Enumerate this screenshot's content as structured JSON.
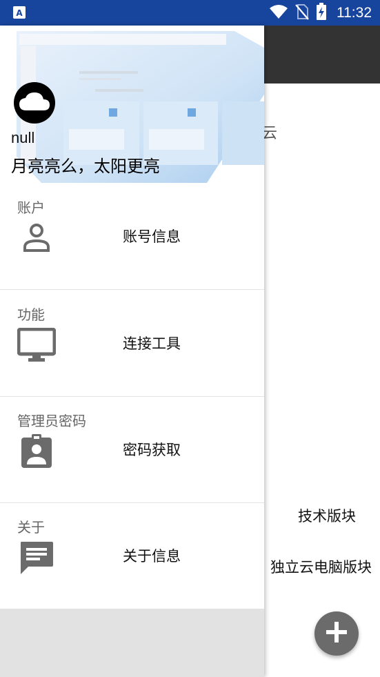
{
  "status_bar": {
    "time": "11:32",
    "icons": [
      "app-notification-icon",
      "wifi-icon",
      "no-sim-icon",
      "battery-charging-icon"
    ]
  },
  "background": {
    "title_fragment": "云",
    "items": [
      "技术版块",
      "独立云电脑版块"
    ],
    "fab_icon": "plus-icon"
  },
  "drawer": {
    "header": {
      "user_name": "null",
      "motto": "月亮亮么，太阳更亮"
    },
    "sections": [
      {
        "title": "账户",
        "item_label": "账号信息",
        "icon": "person-icon"
      },
      {
        "title": "功能",
        "item_label": "连接工具",
        "icon": "monitor-icon"
      },
      {
        "title": "管理员密码",
        "item_label": "密码获取",
        "icon": "badge-icon"
      },
      {
        "title": "关于",
        "item_label": "关于信息",
        "icon": "message-icon"
      }
    ]
  }
}
